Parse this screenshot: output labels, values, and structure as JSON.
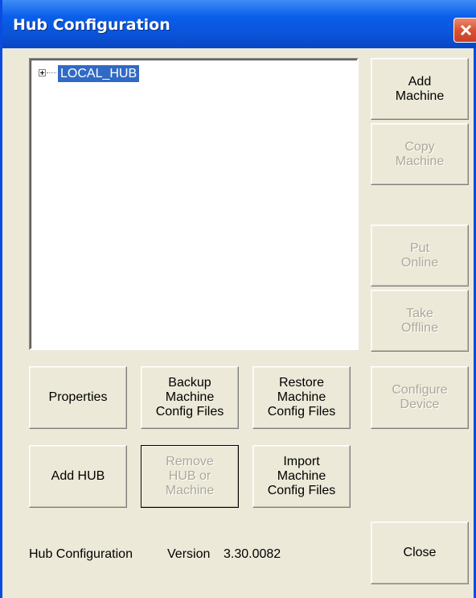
{
  "window": {
    "title": "Hub Configuration",
    "close_icon": "close-x-icon"
  },
  "tree": {
    "root_label": "LOCAL_HUB",
    "expander_icon": "plus-expander-icon"
  },
  "buttons": {
    "add_machine": "Add\nMachine",
    "copy_machine": "Copy\nMachine",
    "put_online": "Put\nOnline",
    "take_offline": "Take\nOffline",
    "configure_device": "Configure\nDevice",
    "properties": "Properties",
    "backup_config": "Backup\nMachine\nConfig Files",
    "restore_config": "Restore\nMachine\nConfig Files",
    "add_hub": "Add HUB",
    "remove_hub": "Remove\nHUB or\nMachine",
    "import_config": "Import\nMachine\nConfig Files",
    "close": "Close"
  },
  "footer": {
    "app_name": "Hub Configuration",
    "version_label": "Version",
    "version": "3.30.0082"
  },
  "colors": {
    "title_bar": "#0a54d9",
    "dialog_bg": "#ece9d8",
    "selection": "#316ac5",
    "close_button": "#d9532f",
    "disabled_text": "#aca899"
  }
}
